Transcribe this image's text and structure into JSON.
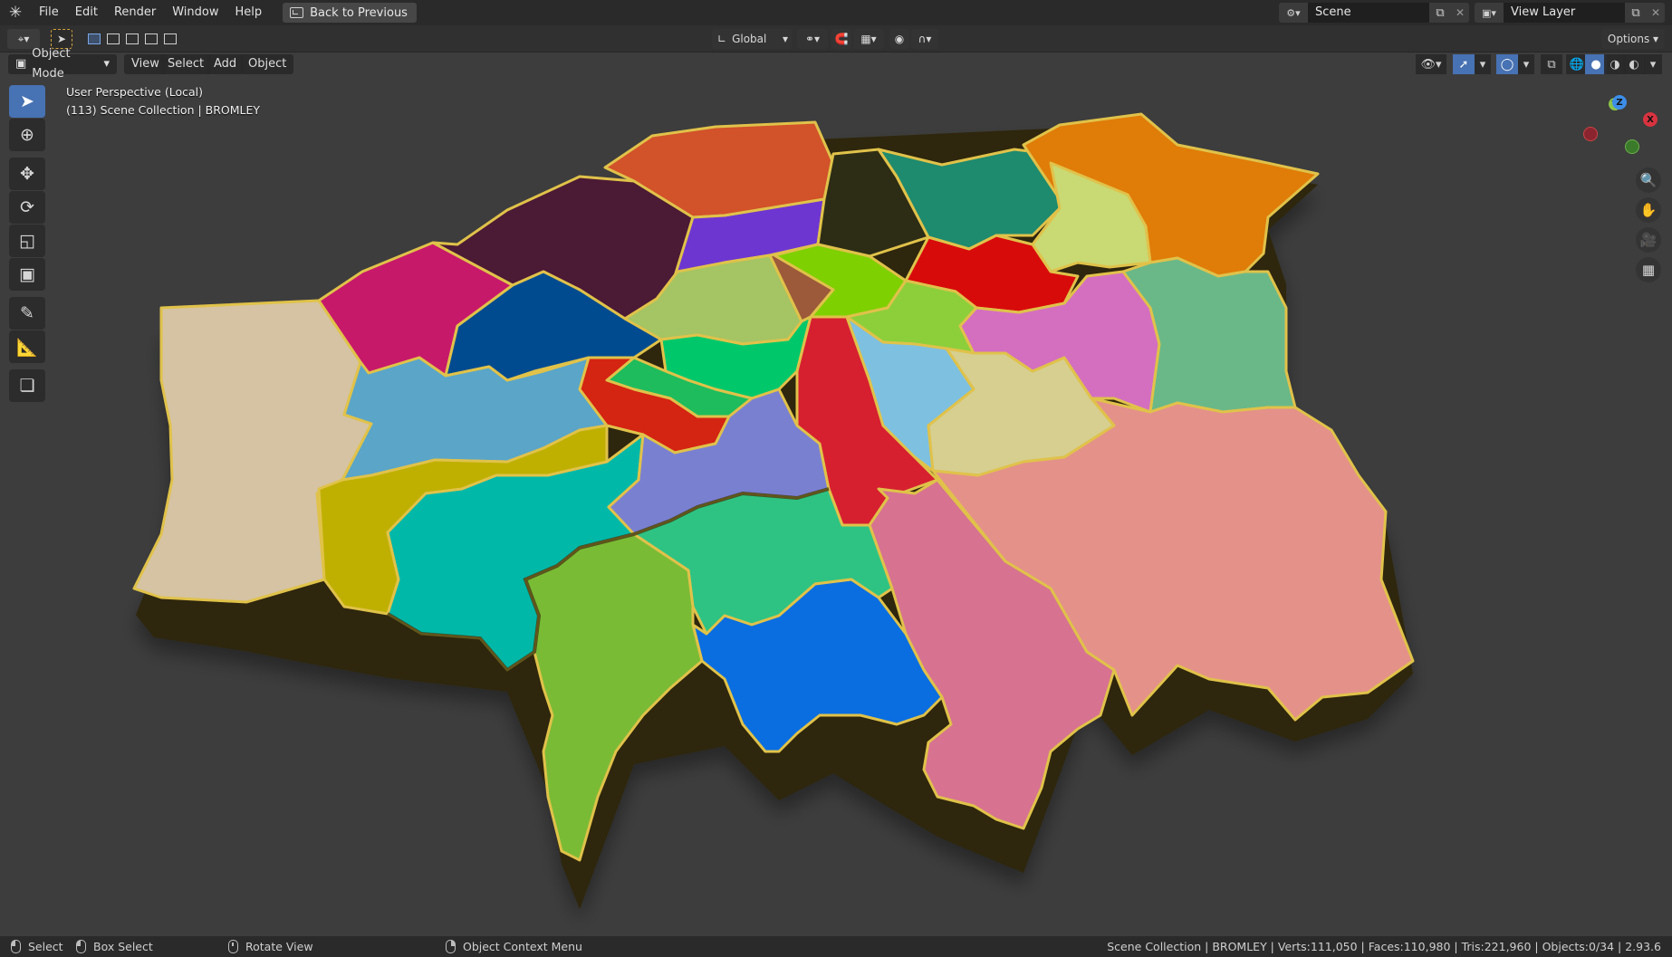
{
  "menu": {
    "items": [
      "File",
      "Edit",
      "Render",
      "Window",
      "Help"
    ],
    "back_button": "Back to Previous"
  },
  "scene": {
    "name": "Scene"
  },
  "view_layer": {
    "name": "View Layer"
  },
  "tool_header": {
    "orientation": "Global",
    "options_label": "Options"
  },
  "viewport_header": {
    "mode": "Object Mode",
    "menus": [
      "View",
      "Select",
      "Add",
      "Object"
    ]
  },
  "overlay": {
    "perspective": "User Perspective (Local)",
    "collection": "(113) Scene Collection | BROMLEY"
  },
  "gizmo": {
    "x_label": "X",
    "y_label": "Y",
    "z_label": "Z"
  },
  "status": {
    "select": "Select",
    "box_select": "Box Select",
    "rotate_view": "Rotate View",
    "context_menu": "Object Context Menu",
    "stats": "Scene Collection | BROMLEY | Verts:111,050 | Faces:110,980 | Tris:221,960 | Objects:0/34 | 2.93.6"
  },
  "colors": {
    "viewport_bg": "#3d3d3d",
    "active_blue": "#4772b3",
    "outline_gold": "#e0c24a",
    "extrusion": "#3a3208",
    "regions": [
      "#d5c3a3",
      "#c7196a",
      "#4b1a35",
      "#d2522a",
      "#6e36d0",
      "#2d2d16",
      "#1e8a6e",
      "#e07c08",
      "#c9d973",
      "#d80b0b",
      "#004b8f",
      "#5aa5c8",
      "#a5c463",
      "#9c5a3a",
      "#7fd000",
      "#00c86a",
      "#d42412",
      "#bfb000",
      "#00b8a8",
      "#7a80d0",
      "#d62030",
      "#7ec0e0",
      "#d6cf90",
      "#d46fc0",
      "#6ab888",
      "#e4918a",
      "#d77290",
      "#2fc383",
      "#0a6ee0",
      "#7abb35",
      "#17b8a8"
    ]
  }
}
